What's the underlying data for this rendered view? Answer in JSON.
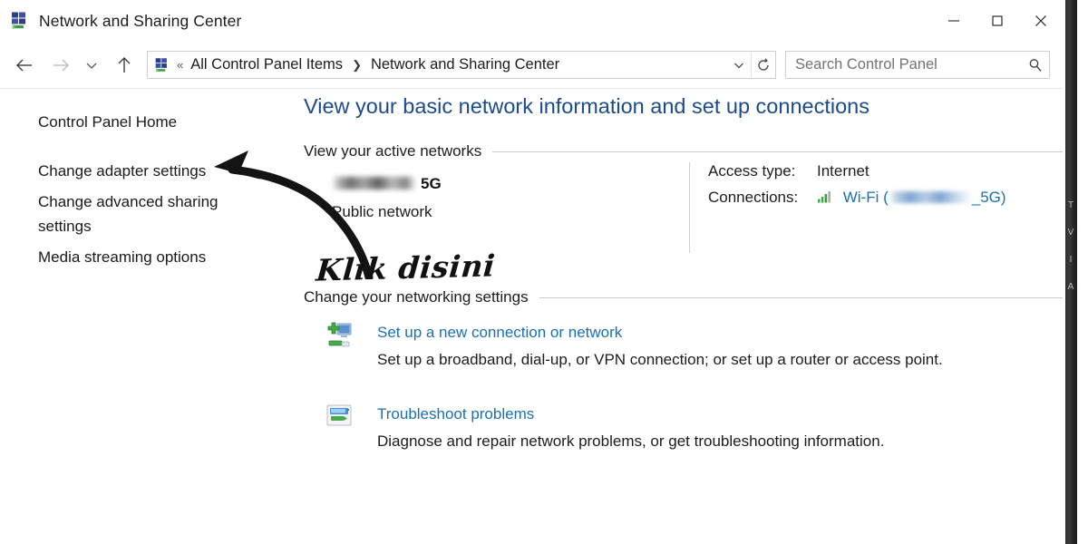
{
  "window": {
    "title": "Network and Sharing Center",
    "icon": "network-sharing-icon",
    "minimize_label": "—",
    "maximize_label": "□",
    "close_label": "✕"
  },
  "navbar": {
    "back_icon": "back-arrow-icon",
    "forward_icon": "forward-arrow-icon",
    "recent_icon": "chevron-down-icon",
    "up_icon": "up-arrow-icon",
    "address_icon": "network-sharing-icon",
    "address_prefix": "«",
    "breadcrumbs": [
      "All Control Panel Items",
      "Network and Sharing Center"
    ],
    "breadcrumb_separator": "❯",
    "dropdown_icon": "chevron-down-icon",
    "refresh_icon": "refresh-icon",
    "search": {
      "placeholder": "Search Control Panel",
      "value": "",
      "icon": "search-icon"
    }
  },
  "sidebar": {
    "items": [
      {
        "label": "Control Panel Home"
      },
      {
        "label": "Change adapter settings"
      },
      {
        "label": "Change advanced sharing settings"
      },
      {
        "label": "Media streaming options"
      }
    ]
  },
  "main": {
    "page_title": "View your basic network information and set up connections",
    "sections": [
      {
        "id": "active",
        "label": "View your active networks"
      },
      {
        "id": "change",
        "label": "Change your networking settings"
      }
    ],
    "active_network": {
      "ssid_redacted": true,
      "ssid_suffix": "5G",
      "network_type": "Public network",
      "details": [
        {
          "label": "Access type:",
          "value": "Internet"
        },
        {
          "label": "Connections:",
          "value_prefix": "Wi-Fi (",
          "value_suffix": "_5G)",
          "icon": "wifi-signal-icon",
          "redacted": true
        }
      ]
    },
    "tasks": [
      {
        "icon": "new-connection-icon",
        "link": "Set up a new connection or network",
        "description": "Set up a broadband, dial-up, or VPN connection; or set up a router or access point."
      },
      {
        "icon": "troubleshoot-icon",
        "link": "Troubleshoot problems",
        "description": "Diagnose and repair network problems, or get troubleshooting information."
      }
    ]
  },
  "annotations": {
    "arrow": "curved-arrow-pointing-to-change-adapter-settings",
    "text": "Klik disini"
  },
  "edge_strip": {
    "glyphs": "T V I A"
  },
  "colors": {
    "heading_blue": "#1c4b8c",
    "link_blue": "#1a6fb5",
    "text": "#1c1c1c",
    "rule": "#c9c9c9",
    "annotation": "#111111"
  }
}
